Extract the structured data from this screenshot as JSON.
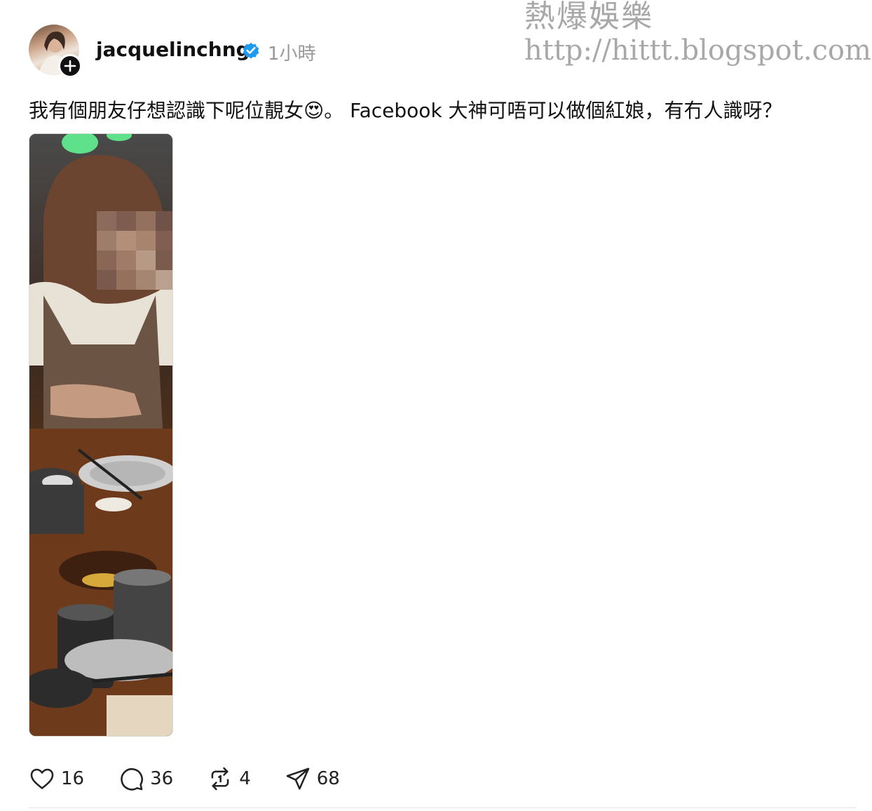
{
  "watermark": {
    "title": "熱爆娛樂",
    "url": "http://hittt.blogspot.com"
  },
  "post": {
    "username": "jacquelinchng",
    "verified": true,
    "time": "1小時",
    "text": "我有個朋友仔想認識下呢位靚女😍。 Facebook 大神可唔可以做個紅娘，有冇人識呀？",
    "image": "blurred-face-woman-restaurant-photo"
  },
  "actions": {
    "likes": "16",
    "comments": "36",
    "reposts": "4",
    "shares": "68"
  },
  "icons": [
    "plus-icon",
    "verified-icon",
    "heart-icon",
    "comment-icon",
    "repost-icon",
    "send-icon"
  ],
  "colors": {
    "verified": "#1d9bf0",
    "text": "#111111",
    "muted": "#999999",
    "watermark": "#a8a8a8"
  }
}
